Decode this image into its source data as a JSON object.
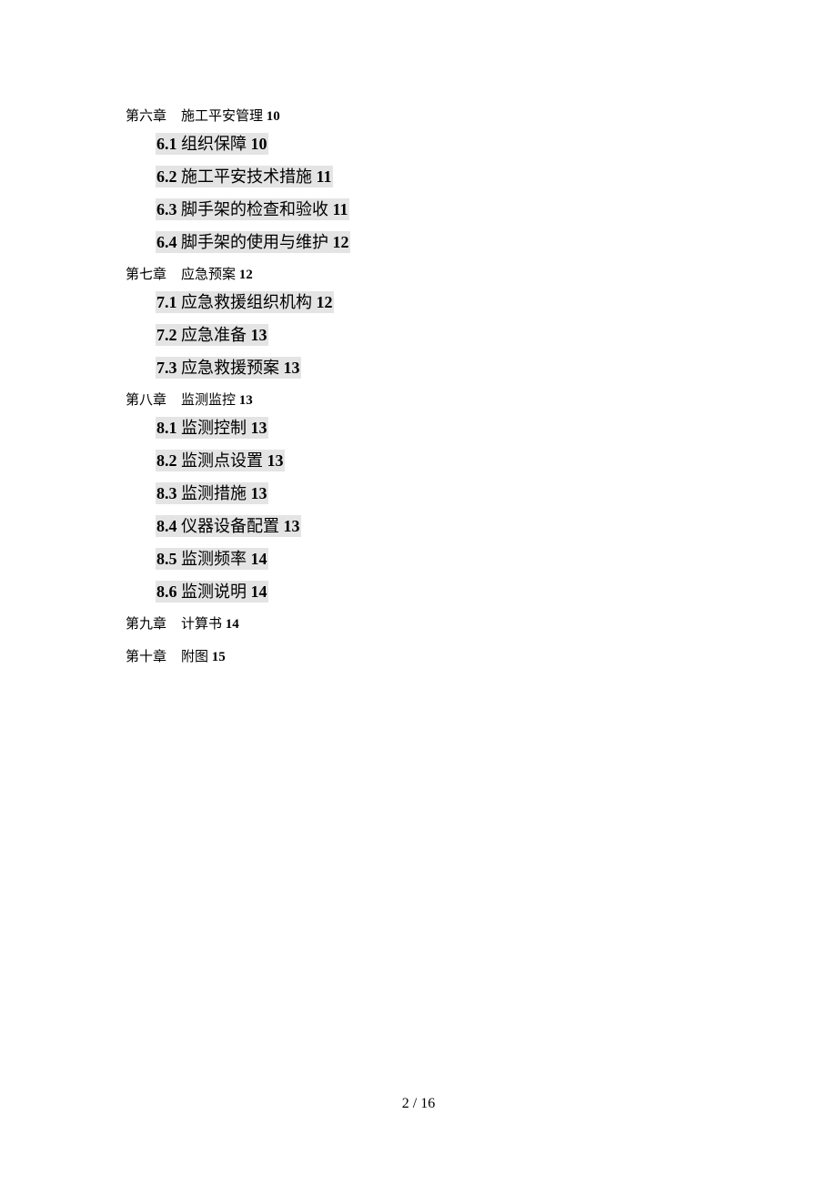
{
  "toc": [
    {
      "chapter": "第六章",
      "title": "施工平安管理",
      "page": "10",
      "sections": [
        {
          "num": "6.1",
          "title": "组织保障",
          "page": "10"
        },
        {
          "num": "6.2",
          "title": "施工平安技术措施",
          "page": "11"
        },
        {
          "num": "6.3",
          "title": "脚手架的检查和验收",
          "page": "11"
        },
        {
          "num": "6.4",
          "title": "脚手架的使用与维护",
          "page": "12"
        }
      ]
    },
    {
      "chapter": "第七章",
      "title": "应急预案",
      "page": "12",
      "sections": [
        {
          "num": "7.1",
          "title": "应急救援组织机构",
          "page": "12"
        },
        {
          "num": "7.2",
          "title": "应急准备",
          "page": "13"
        },
        {
          "num": "7.3",
          "title": "应急救援预案",
          "page": "13"
        }
      ]
    },
    {
      "chapter": "第八章",
      "title": "监测监控",
      "page": "13",
      "sections": [
        {
          "num": "8.1",
          "title": "监测控制",
          "page": "13"
        },
        {
          "num": "8.2",
          "title": "监测点设置",
          "page": "13"
        },
        {
          "num": "8.3",
          "title": "监测措施",
          "page": "13"
        },
        {
          "num": "8.4",
          "title": "仪器设备配置",
          "page": "13"
        },
        {
          "num": "8.5",
          "title": "监测频率",
          "page": "14"
        },
        {
          "num": "8.6",
          "title": "监测说明",
          "page": "14"
        }
      ]
    },
    {
      "chapter": "第九章",
      "title": "计算书",
      "page": "14",
      "sections": []
    },
    {
      "chapter": "第十章",
      "title": "附图",
      "page": "15",
      "sections": []
    }
  ],
  "footer": {
    "page_current": "2",
    "separator": "/",
    "page_total": "16"
  }
}
